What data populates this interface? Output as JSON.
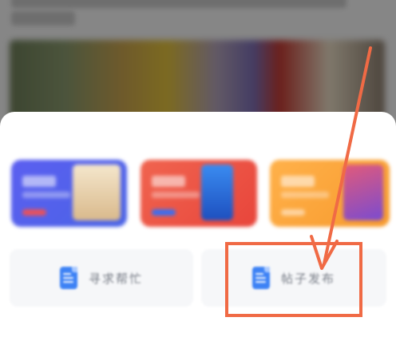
{
  "background_page": {
    "title": ""
  },
  "promo_cards": [
    {
      "name": "promo-card-1",
      "color": "#5b5ff0"
    },
    {
      "name": "promo-card-2",
      "color": "#f0644f"
    },
    {
      "name": "promo-card-3",
      "color": "#ffb14a"
    }
  ],
  "actions": {
    "help": {
      "label": "寻求帮忙",
      "icon": "document-icon"
    },
    "post": {
      "label": "帖子发布",
      "icon": "document-icon"
    }
  },
  "annotation": {
    "color": "#f06a45",
    "target": "post"
  }
}
